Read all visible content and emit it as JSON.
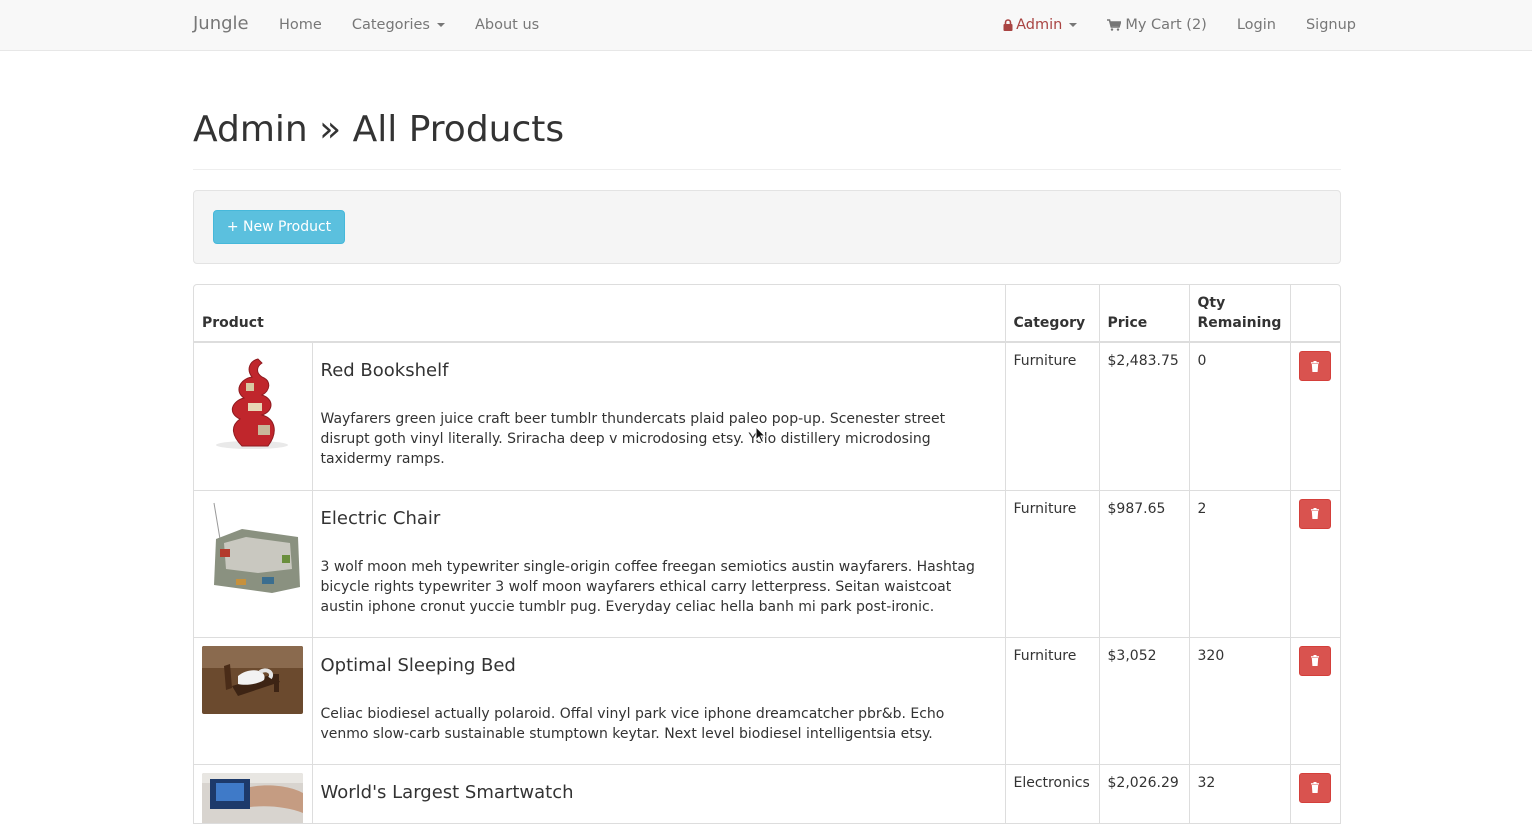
{
  "navbar": {
    "brand": "Jungle",
    "left_items": [
      {
        "label": "Home",
        "dropdown": false
      },
      {
        "label": "Categories",
        "dropdown": true
      },
      {
        "label": "About us",
        "dropdown": false
      }
    ],
    "admin_label": "Admin",
    "cart_label": "My Cart (2)",
    "login_label": "Login",
    "signup_label": "Signup"
  },
  "page": {
    "title": "Admin » All Products",
    "new_product_label": "+ New Product"
  },
  "table": {
    "headers": {
      "product": "Product",
      "category": "Category",
      "price": "Price",
      "qty": "Qty Remaining"
    },
    "rows": [
      {
        "name": "Red Bookshelf",
        "description": "Wayfarers green juice craft beer tumblr thundercats plaid paleo pop-up. Scenester street disrupt goth vinyl literally. Sriracha deep v microdosing etsy. Yolo distillery microdosing taxidermy ramps.",
        "category": "Furniture",
        "price": "$2,483.75",
        "qty": "0",
        "thumb": "red-bookshelf"
      },
      {
        "name": "Electric Chair",
        "description": "3 wolf moon meh typewriter single-origin coffee freegan semiotics austin wayfarers. Hashtag bicycle rights typewriter 3 wolf moon wayfarers ethical carry letterpress. Seitan waistcoat austin iphone cronut yuccie tumblr pug. Everyday celiac hella banh mi park post-ironic.",
        "category": "Furniture",
        "price": "$987.65",
        "qty": "2",
        "thumb": "electric-chair"
      },
      {
        "name": "Optimal Sleeping Bed",
        "description": "Celiac biodiesel actually polaroid. Offal vinyl park vice iphone dreamcatcher pbr&b. Echo venmo slow-carb sustainable stumptown keytar. Next level biodiesel intelligentsia etsy.",
        "category": "Furniture",
        "price": "$3,052",
        "qty": "320",
        "thumb": "sleeping-bed"
      },
      {
        "name": "World's Largest Smartwatch",
        "description": "",
        "category": "Electronics",
        "price": "$2,026.29",
        "qty": "32",
        "thumb": "smartwatch"
      }
    ]
  },
  "colors": {
    "navbar_bg": "#f8f8f8",
    "info_button": "#5bc0de",
    "danger_button": "#d9534f",
    "admin_accent": "#a94442"
  }
}
